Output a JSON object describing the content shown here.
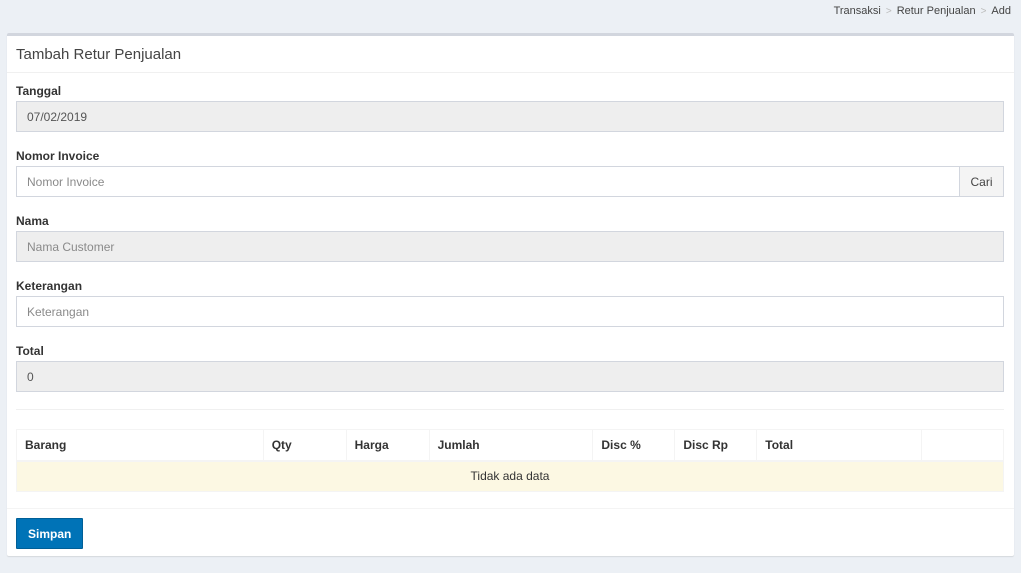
{
  "breadcrumb": {
    "items": [
      "Transaksi",
      "Retur Penjualan",
      "Add"
    ],
    "separator": ">"
  },
  "box": {
    "title": "Tambah Retur Penjualan"
  },
  "form": {
    "tanggal": {
      "label": "Tanggal",
      "value": "07/02/2019",
      "placeholder": ""
    },
    "invoice": {
      "label": "Nomor Invoice",
      "value": "",
      "placeholder": "Nomor Invoice",
      "button_label": "Cari"
    },
    "nama": {
      "label": "Nama",
      "value": "",
      "placeholder": "Nama Customer"
    },
    "keterangan": {
      "label": "Keterangan",
      "value": "",
      "placeholder": "Keterangan"
    },
    "total": {
      "label": "Total",
      "value": "0",
      "placeholder": ""
    }
  },
  "table": {
    "columns": [
      "Barang",
      "Qty",
      "Harga",
      "Jumlah",
      "Disc %",
      "Disc Rp",
      "Total",
      ""
    ],
    "empty_text": "Tidak ada data"
  },
  "footer": {
    "save_label": "Simpan"
  },
  "colors": {
    "primary": "#0073b7",
    "empty_row": "#fcf8e3",
    "background": "#ecf0f5"
  }
}
